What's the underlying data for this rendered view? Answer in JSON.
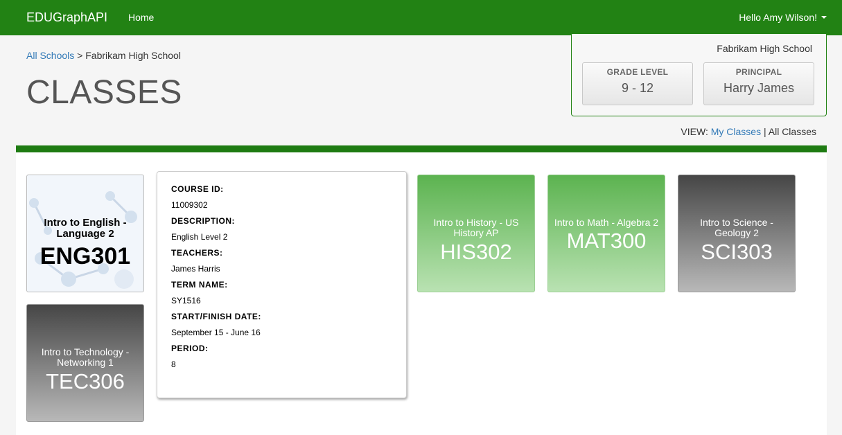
{
  "navbar": {
    "brand": "EDUGraphAPI",
    "home": "Home",
    "user_greeting": "Hello Amy Wilson!"
  },
  "breadcrumb": {
    "root": "All Schools",
    "separator": " > ",
    "current": "Fabrikam High School"
  },
  "page_title": "CLASSES",
  "school_info": {
    "name": "Fabrikam High School",
    "grade_label": "GRADE LEVEL",
    "grade_value": "9 - 12",
    "principal_label": "PRINCIPAL",
    "principal_value": "Harry James"
  },
  "view_switch": {
    "prefix": "VIEW:",
    "my_classes": "My Classes",
    "separator": "|",
    "all_classes": "All Classes"
  },
  "classes": [
    {
      "name": "Intro to English - Language 2",
      "code": "ENG301",
      "style": "light"
    },
    {
      "name": "Intro to Technology - Networking 1",
      "code": "TEC306",
      "style": "dark"
    },
    {
      "name": "Intro to History - US History AP",
      "code": "HIS302",
      "style": "green"
    },
    {
      "name": "Intro to Math - Algebra 2",
      "code": "MAT300",
      "style": "green"
    },
    {
      "name": "Intro to Science - Geology 2",
      "code": "SCI303",
      "style": "dark"
    }
  ],
  "detail": {
    "course_id_label": "COURSE ID:",
    "course_id": "11009302",
    "description_label": "DESCRIPTION:",
    "description": "English Level 2",
    "teachers_label": "TEACHERS:",
    "teachers": "James Harris",
    "term_label": "TERM NAME:",
    "term": "SY1516",
    "dates_label": "START/FINISH DATE:",
    "dates": "September 15 - June 16",
    "period_label": "PERIOD:",
    "period": "8"
  },
  "colors": {
    "nav_green": "#228214",
    "bar_green": "#1e7b12",
    "link_blue": "#337ab7"
  }
}
